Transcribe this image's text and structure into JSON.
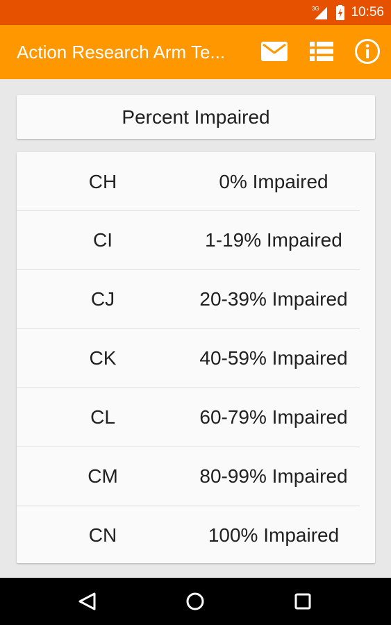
{
  "status_bar": {
    "network_label": "3G",
    "time": "10:56"
  },
  "app_bar": {
    "title": "Action Research Arm Te...",
    "actions": [
      {
        "name": "email",
        "icon": "mail-icon"
      },
      {
        "name": "list",
        "icon": "list-icon"
      },
      {
        "name": "info",
        "icon": "info-icon"
      }
    ]
  },
  "header_card": {
    "title": "Percent Impaired"
  },
  "impairment_rows": [
    {
      "code": "CH",
      "description": "0% Impaired"
    },
    {
      "code": "CI",
      "description": "1-19% Impaired"
    },
    {
      "code": "CJ",
      "description": "20-39% Impaired"
    },
    {
      "code": "CK",
      "description": "40-59% Impaired"
    },
    {
      "code": "CL",
      "description": "60-79% Impaired"
    },
    {
      "code": "CM",
      "description": "80-99% Impaired"
    },
    {
      "code": "CN",
      "description": "100% Impaired"
    }
  ],
  "nav_bar": {
    "buttons": [
      "back-icon",
      "home-icon",
      "recents-icon"
    ]
  },
  "colors": {
    "status_bar": "#e65100",
    "app_bar": "#ff9800",
    "background": "#e8e8e8",
    "card": "#fafafa",
    "text": "#212121",
    "nav_bar": "#000000"
  }
}
